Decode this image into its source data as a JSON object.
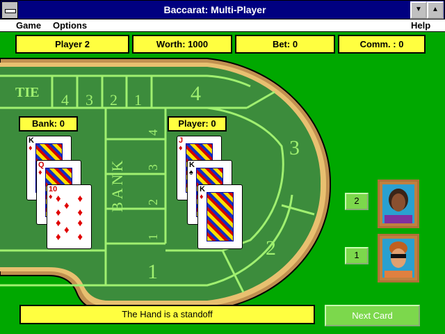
{
  "window": {
    "title": "Baccarat: Multi-Player",
    "minimize_glyph": "▼",
    "maximize_glyph": "▲"
  },
  "menu": {
    "game": "Game",
    "options": "Options",
    "help": "Help"
  },
  "info": {
    "player": "Player 2",
    "worth": "Worth: 1000",
    "bet": "Bet: 0",
    "comm": "Comm. : 0"
  },
  "table": {
    "tie_label": "TIE",
    "tie_numbers": [
      "4",
      "3",
      "2",
      "1"
    ],
    "bank_label": "BANK",
    "bank_numbers": [
      "4",
      "3",
      "2",
      "1"
    ],
    "zone_numbers": {
      "four": "4",
      "three": "3",
      "two": "2",
      "one": "1"
    }
  },
  "bank_hand": {
    "label": "Bank: 0",
    "cards": [
      {
        "rank": "K",
        "suit": "♦"
      },
      {
        "rank": "Q",
        "suit": "♦"
      },
      {
        "rank": "10",
        "suit": "♦"
      }
    ]
  },
  "player_hand": {
    "label": "Player: 0",
    "cards": [
      {
        "rank": "J",
        "suit": "♦"
      },
      {
        "rank": "K",
        "suit": "♠"
      },
      {
        "rank": "K",
        "suit": "♦"
      }
    ]
  },
  "seats": [
    {
      "number": "2",
      "avatar_icon": "woman-portrait-icon"
    },
    {
      "number": "1",
      "avatar_icon": "man-sunglasses-portrait-icon"
    }
  ],
  "status": "The Hand is a standoff",
  "next_card": "Next Card",
  "colors": {
    "felt": "#00a800",
    "table": "#3c8c3c",
    "line": "#a0f070",
    "yellow": "#ffff40",
    "titlebar": "#000080"
  }
}
